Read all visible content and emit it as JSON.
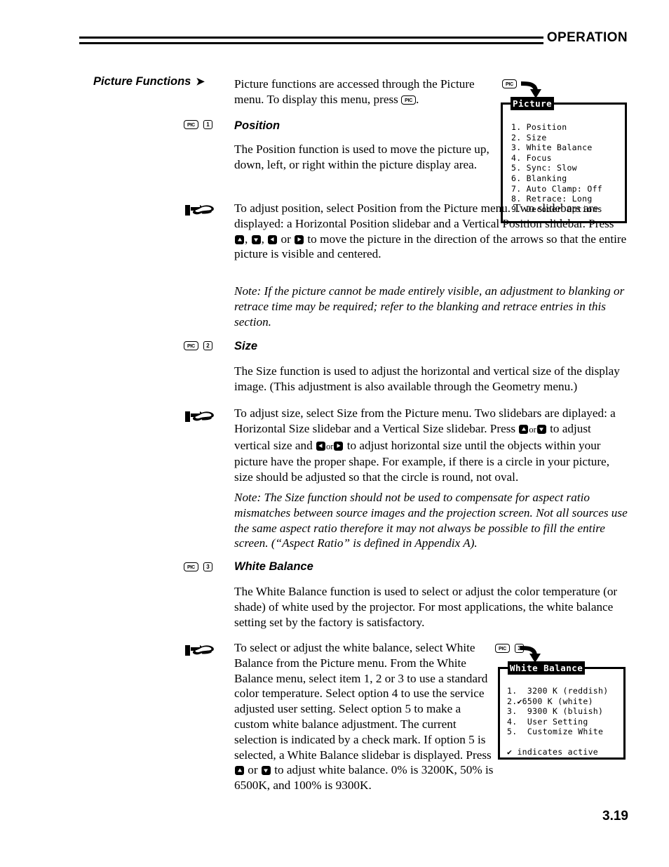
{
  "header": {
    "title": "OPERATION"
  },
  "page_number": "3.19",
  "section": {
    "heading": "Picture Functions",
    "heading_arrow": "➤",
    "intro": "Picture functions are accessed through the Picture menu. To display this menu, press "
  },
  "keys": {
    "pic_label": "PIC",
    "num_1": "1",
    "num_2": "2",
    "num_3": "3",
    "arrow_up": "up-arrow-key",
    "arrow_down": "down-arrow-key",
    "arrow_left": "left-arrow-key",
    "arrow_right": "right-arrow-key",
    "or": "or",
    "hand": "pointing-hand-icon"
  },
  "position": {
    "title": "Position",
    "body": "The Position function is used to move the picture up, down, left, or right within the picture display area.",
    "instruction_part1": "To adjust position, select Position from the Picture menu. Two slidebars are displayed: a Horizontal Position slidebar and a Vertical Position slidebar. Press ",
    "instruction_part2": ", ",
    "instruction_part3": ", ",
    "instruction_part4": " or ",
    "instruction_part5": " to move the picture in the direction of the arrows so that the entire picture is visible and centered.",
    "note": "Note: If the picture cannot be made entirely visible, an adjustment to blanking or retrace time may be required; refer to the blanking and retrace entries in this section."
  },
  "size": {
    "title": "Size",
    "body": "The Size function is used to adjust the horizontal and vertical size of the display image. (This adjustment is also available through the Geometry menu.)",
    "instruction_part1": "To adjust size, select Size from the Picture menu. Two slidebars are diplayed: a Horizontal Size slidebar and a Vertical Size slidebar. Press ",
    "instruction_part2": " to adjust vertical size and ",
    "instruction_part3": " to adjust horizontal size until the objects within your picture have the proper shape. For example, if there is a circle in your picture, size should be adjusted so that the circle is round, not oval.",
    "note": "Note: The Size function should not be used to compensate for aspect ratio mismatches between source images and the projection screen. Not all sources use the same aspect ratio therefore it may not always be possible to fill the entire screen. (“Aspect Ratio” is defined in Appendix A)."
  },
  "white_balance": {
    "title": "White Balance",
    "body": "The White Balance function is used to select or adjust the color temperature (or shade) of white used by the projector. For most applications, the white balance setting set by the factory is satisfactory.",
    "instruction_part1": "To select or adjust the white balance, select White Balance from the Picture menu. From the White Balance menu, select item 1, 2 or 3 to use a standard color temperature. Select option 4 to use the service adjusted user setting. Select option 5 to make a custom white balance adjustment. The current selection is indicated by a check mark. If option 5 is selected, a White Balance slidebar is displayed. Press ",
    "instruction_part2": " or ",
    "instruction_part3": " to adjust white balance. 0% is 3200K, 50% is 6500K, and 100% is 9300K."
  },
  "picture_menu": {
    "title": "Picture",
    "items": [
      "1. Position",
      "2. Size",
      "3. White Balance",
      "4. Focus",
      "5. Sync: Slow",
      "6. Blanking",
      "7. Auto Clamp: Off",
      "8. Retrace: Long",
      "9. Decoder Options"
    ]
  },
  "white_balance_menu": {
    "title": "White Balance",
    "items": [
      "1.  3200 K (reddish)",
      "2.✔6500 K (white)",
      "3.  9300 K (bluish)",
      "4.  User Setting",
      "5.  Customize White"
    ],
    "footer": "✔ indicates active"
  }
}
